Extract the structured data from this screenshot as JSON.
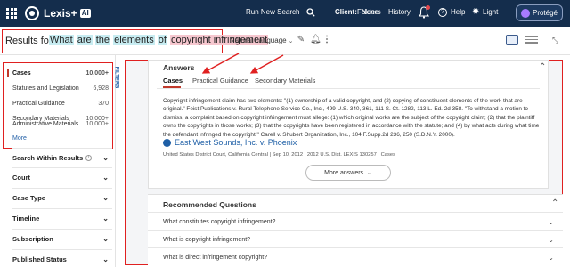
{
  "topbar": {
    "brand": "Lexis+",
    "brand_badge": "AI",
    "run_new_search": "Run New Search",
    "client_label": "Client:",
    "client_value": "-None-",
    "folders": "Folders",
    "history": "History",
    "help": "Help",
    "light": "Light",
    "protege": "Protégé"
  },
  "search": {
    "results_for": "Results for:",
    "words": [
      "What",
      "are",
      "the",
      "elements",
      "of"
    ],
    "highlight_phrase": "copyright infringement",
    "mode": "Natural Language"
  },
  "sidebar": {
    "categories": [
      {
        "label": "Cases",
        "count": "10,000+",
        "active": true
      },
      {
        "label": "Statutes and Legislation",
        "count": "6,928"
      },
      {
        "label": "Practical Guidance",
        "count": "370"
      },
      {
        "label": "Secondary Materials",
        "count": "10,000+"
      },
      {
        "label": "Administrative Materials",
        "count": "10,000+"
      }
    ],
    "more": "More",
    "filters_label": "FILTERS",
    "filters": [
      "Search Within Results",
      "Court",
      "Case Type",
      "Timeline",
      "Subscription",
      "Published Status"
    ]
  },
  "answers": {
    "title": "Answers",
    "tabs": [
      "Cases",
      "Practical Guidance",
      "Secondary Materials"
    ],
    "text": "Copyright infringement claim has two elements: \"(1) ownership of a valid copyright, and (2) copying of constituent elements of the work that are original.\" Feist Publications v. Rural Telephone Service Co., Inc., 499 U.S. 340, 361, 111 S. Ct. 1282, 113 L. Ed. 2d 358. \"To withstand a motion to dismiss, a complaint based on copyright infringement must allege: (1) which original works are the subject of the copyright claim; (2) that the plaintiff owns the copyrights in those works; (3) that the copyrights have been registered in accordance with the statute; and (4) by what acts during what time the defendant infringed the copyright.\" Carell v. Shubert Organization, Inc., 104 F.Supp.2d 236, 250 (S.D.N.Y. 2000).",
    "case_title": "East West Sounds, Inc. v. Phoenix",
    "case_meta": "United States District Court, California Central  |  Sep 10, 2012  |  2012 U.S. Dist. LEXIS 130257  |  Cases",
    "more_answers": "More answers"
  },
  "recommended": {
    "title": "Recommended Questions",
    "questions": [
      "What constitutes copyright infringement?",
      "What is copyright infringement?",
      "What is direct infringement copyright?"
    ]
  },
  "colors": {
    "topbar": "#142d4c",
    "annotation_red": "#e02020",
    "link_blue": "#1e5fa6",
    "active_tab": "#c0392b"
  }
}
